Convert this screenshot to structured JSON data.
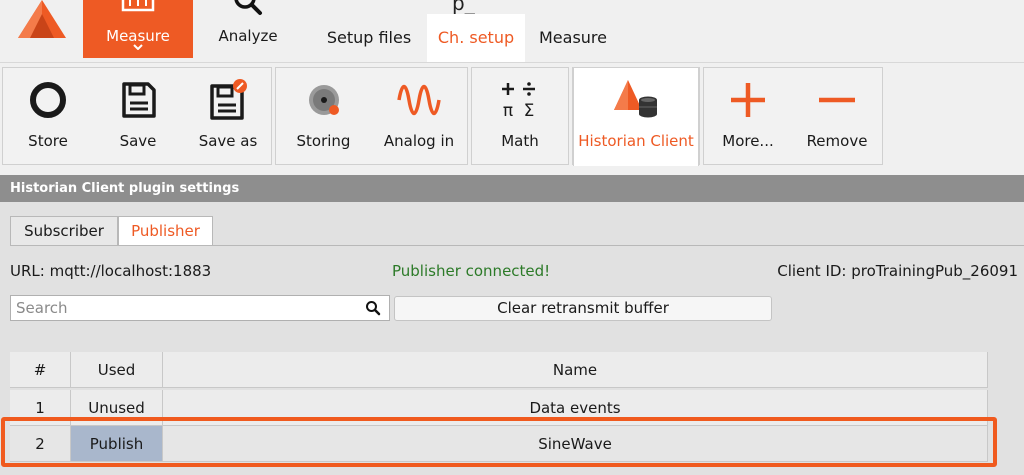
{
  "header": {
    "modes": [
      {
        "label": "Measure",
        "icon": "measure-icon",
        "active": true
      },
      {
        "label": "Analyze",
        "icon": "magnifier-icon",
        "active": false
      }
    ],
    "title_fragment": "p_",
    "subtabs": [
      {
        "label": "Setup files",
        "active": false
      },
      {
        "label": "Ch. setup",
        "active": true
      },
      {
        "label": "Measure",
        "active": false
      }
    ]
  },
  "toolbar": {
    "store": {
      "label": "Store",
      "icon": "record-circle-icon"
    },
    "save": {
      "label": "Save",
      "icon": "floppy-disk-icon"
    },
    "save_as": {
      "label": "Save as",
      "icon": "floppy-disk-edit-icon"
    },
    "storing": {
      "label": "Storing",
      "icon": "disk-storing-icon"
    },
    "analog_in": {
      "label": "Analog in",
      "icon": "sine-wave-icon"
    },
    "math": {
      "label": "Math",
      "icon": "math-operators-icon"
    },
    "historian": {
      "label": "Historian Client",
      "icon": "historian-client-icon",
      "active": true
    },
    "more": {
      "label": "More...",
      "icon": "plus-icon"
    },
    "remove": {
      "label": "Remove",
      "icon": "minus-icon"
    }
  },
  "settings": {
    "title": "Historian Client plugin settings",
    "tabs": [
      {
        "label": "Subscriber",
        "active": false
      },
      {
        "label": "Publisher",
        "active": true
      }
    ],
    "url": "URL: mqtt://localhost:1883",
    "status": "Publisher connected!",
    "client_id": "Client ID: proTrainingPub_26091",
    "search": {
      "placeholder": "Search",
      "value": ""
    },
    "clear_button": "Clear retransmit buffer"
  },
  "table": {
    "columns": [
      "#",
      "Used",
      "Name"
    ],
    "rows": [
      {
        "num": "1",
        "used": "Unused",
        "name": "Data events"
      },
      {
        "num": "2",
        "used": "Publish",
        "name": "SineWave",
        "highlighted": true
      }
    ]
  },
  "colors": {
    "accent": "#ee5a24",
    "status_ok": "#2c7a28",
    "section_bar": "#8e8e8e",
    "selected_cell": "#a9b7cc"
  }
}
